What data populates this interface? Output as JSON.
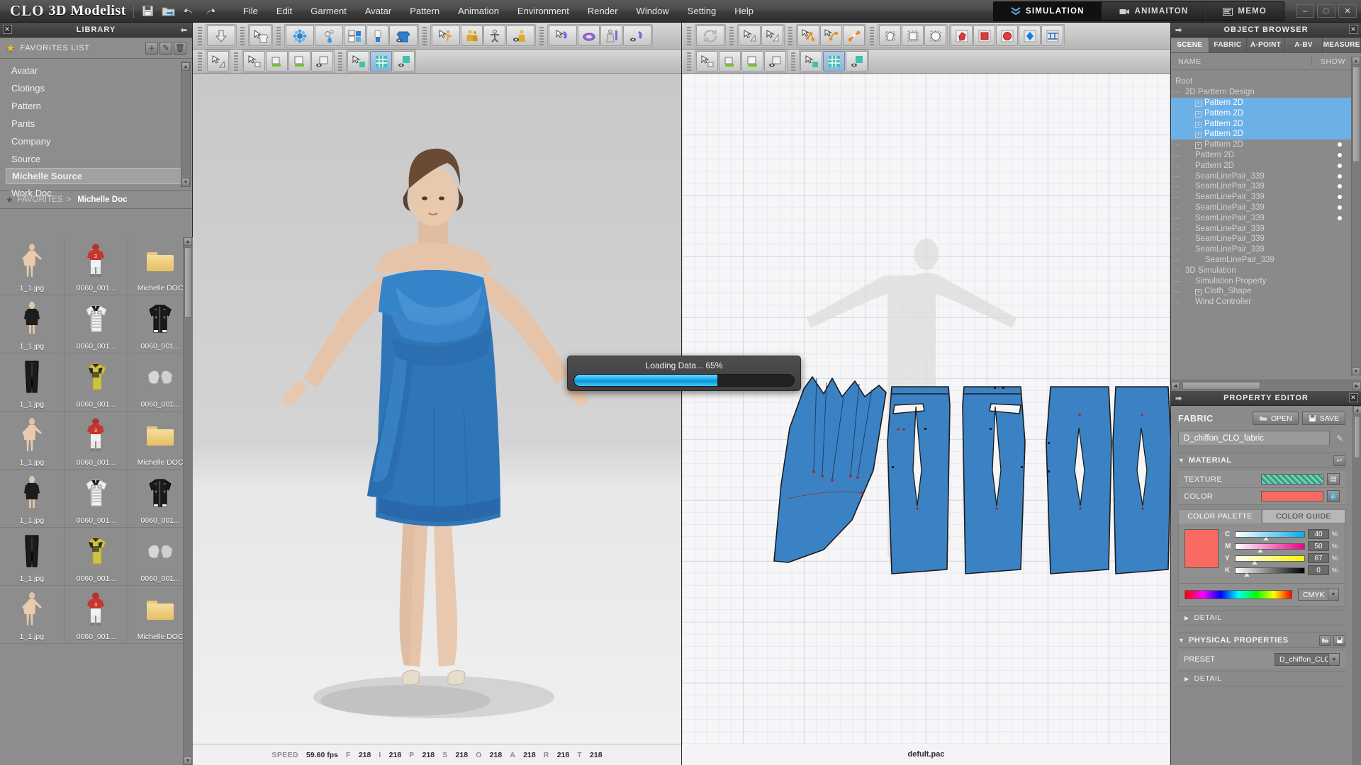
{
  "app": {
    "brand_clo": "CLO",
    "brand_suffix": "3D Modelist",
    "window_buttons": {
      "minimize": "–",
      "maximize": "□",
      "close": "✕"
    }
  },
  "titlebar": {
    "quick_icons": [
      {
        "name": "save-icon",
        "title": "Save"
      },
      {
        "name": "open-folder-icon",
        "title": "Open"
      },
      {
        "name": "undo-icon",
        "title": "Undo"
      },
      {
        "name": "redo-icon",
        "title": "Redo"
      }
    ],
    "menu": [
      "File",
      "Edit",
      "Garment",
      "Avatar",
      "Pattern",
      "Animation",
      "Environment",
      "Render",
      "Window",
      "Setting",
      "Help"
    ],
    "modes": [
      {
        "label": "SIMULATION",
        "icon": "chevrons-down-icon",
        "active": true
      },
      {
        "label": "ANIMAITON",
        "icon": "video-camera-icon",
        "active": false
      },
      {
        "label": "MEMO",
        "icon": "note-lines-icon",
        "active": false
      }
    ]
  },
  "library": {
    "title": "LIBRARY",
    "favorites_label": "FAVORITES LIST",
    "favorites_buttons": [
      {
        "name": "add-favorite-button",
        "glyph": "＋"
      },
      {
        "name": "edit-favorite-button",
        "glyph": "✎"
      },
      {
        "name": "delete-favorite-button",
        "glyph": "🗑"
      }
    ],
    "items": [
      {
        "label": "Avatar",
        "selected": false
      },
      {
        "label": "Clotings",
        "selected": false
      },
      {
        "label": "Pattern",
        "selected": false
      },
      {
        "label": "Pants",
        "selected": false
      },
      {
        "label": "Company",
        "selected": false
      },
      {
        "label": "Source",
        "selected": false
      },
      {
        "label": "Michelle Source",
        "selected": true
      },
      {
        "label": "Work Doc",
        "selected": false
      }
    ],
    "breadcrumb_root": "FAVORITES",
    "breadcrumb_sep": ">",
    "breadcrumb_current": "Michelle Doc",
    "thumbnails": [
      {
        "caption": "1_1.jpg",
        "art": "avatar-nude"
      },
      {
        "caption": "0060_001...",
        "art": "football-player"
      },
      {
        "caption": "Michelle DOC",
        "art": "folder"
      },
      {
        "caption": "1_1.jpg",
        "art": "black-dress"
      },
      {
        "caption": "0060_001...",
        "art": "striped-polo"
      },
      {
        "caption": "0060_001...",
        "art": "black-jacket"
      },
      {
        "caption": "1_1.jpg",
        "art": "black-pants"
      },
      {
        "caption": "0060_001...",
        "art": "yellow-tee"
      },
      {
        "caption": "0060_001...",
        "art": "shoulder-pads"
      },
      {
        "caption": "1_1.jpg",
        "art": "avatar-nude"
      },
      {
        "caption": "0060_001...",
        "art": "football-player"
      },
      {
        "caption": "Michelle DOC",
        "art": "folder"
      },
      {
        "caption": "1_1.jpg",
        "art": "black-dress"
      },
      {
        "caption": "0060_001...",
        "art": "striped-polo"
      },
      {
        "caption": "0060_001...",
        "art": "black-jacket"
      },
      {
        "caption": "1_1.jpg",
        "art": "black-pants"
      },
      {
        "caption": "0060_001...",
        "art": "yellow-tee"
      },
      {
        "caption": "0060_001...",
        "art": "shoulder-pads"
      },
      {
        "caption": "1_1.jpg",
        "art": "avatar-nude"
      },
      {
        "caption": "0060_001...",
        "art": "football-player"
      },
      {
        "caption": "Michelle DOC",
        "art": "folder"
      }
    ]
  },
  "viewport3d": {
    "status": {
      "speed_label": "SPEED",
      "speed_value": "59.60 fps",
      "counters": [
        {
          "key": "F",
          "value": "218"
        },
        {
          "key": "I",
          "value": "218"
        },
        {
          "key": "P",
          "value": "218"
        },
        {
          "key": "S",
          "value": "218"
        },
        {
          "key": "O",
          "value": "218"
        },
        {
          "key": "A",
          "value": "218"
        },
        {
          "key": "R",
          "value": "218"
        },
        {
          "key": "T",
          "value": "218"
        }
      ]
    },
    "toolbar_row1": [
      "gravity-drop-icon",
      "select-mesh-icon",
      "particle-distance-icon",
      "pin-drop-icon",
      "fold-arrange-icon",
      "tack-icon",
      "garment-hide-icon",
      "avatar-motion-icon",
      "avatar-pose-icon",
      "avatar-xray-icon",
      "avatar-hide-icon",
      "zipper-select-icon",
      "ring-icon",
      "avatar-measure-icon",
      "zipper-icon"
    ],
    "toolbar_row2": [
      "transform-icon",
      "select-pattern-icon",
      "flatten-icon",
      "arrange-icon",
      "layer-icon",
      "select-texture-icon",
      "texture-grid-icon",
      "texture-hide-icon"
    ]
  },
  "viewport2d": {
    "filename": "defult.pac",
    "toolbar_row1": [
      "sync-icon",
      "select-edit-icon",
      "edit-curve-icon",
      "transform-point-icon",
      "select-point-icon",
      "add-point-icon",
      "polygon-icon",
      "rectangle-icon",
      "circle-icon",
      "internal-polygon-icon",
      "internal-rect-icon",
      "internal-circle-icon",
      "dart-icon",
      "pleat-icon"
    ],
    "toolbar_row2": [
      "select-seam-icon",
      "seam-segment-icon",
      "seam-free-icon",
      "seam-hide-icon",
      "select-texture-icon",
      "texture-grid-icon",
      "texture-hide-icon"
    ],
    "patterns": [
      "draped-ruffle-panel",
      "front-left-panel",
      "front-right-panel",
      "back-left-panel",
      "back-right-panel"
    ]
  },
  "object_browser": {
    "title": "OBJECT BROWSER",
    "tabs": [
      {
        "label": "SCENE",
        "active": true
      },
      {
        "label": "FABRIC",
        "active": false
      },
      {
        "label": "A-POINT",
        "active": false
      },
      {
        "label": "A-BV",
        "active": false
      },
      {
        "label": "MEASURE",
        "active": false
      }
    ],
    "columns": {
      "name": "NAME",
      "show": "SHOW"
    },
    "tree": [
      {
        "label": "Root",
        "depth": 0,
        "expander": false,
        "selected": false,
        "dot": false
      },
      {
        "label": "2D Parttern Design",
        "depth": 1,
        "expander": false,
        "selected": false,
        "dot": false
      },
      {
        "label": "Pattern 2D",
        "depth": 2,
        "expander": true,
        "selected": true,
        "dot": false
      },
      {
        "label": "Pattern 2D",
        "depth": 2,
        "expander": true,
        "selected": true,
        "dot": false
      },
      {
        "label": "Pattern 2D",
        "depth": 2,
        "expander": true,
        "selected": true,
        "dot": false
      },
      {
        "label": "Pattern 2D",
        "depth": 2,
        "expander": true,
        "selected": true,
        "dot": false
      },
      {
        "label": "Pattern 2D",
        "depth": 2,
        "expander": true,
        "selected": false,
        "dot": true
      },
      {
        "label": "Pattern 2D",
        "depth": 2,
        "expander": false,
        "selected": false,
        "dot": true
      },
      {
        "label": "Pattern 2D",
        "depth": 2,
        "expander": false,
        "selected": false,
        "dot": true
      },
      {
        "label": "SeamLinePair_339",
        "depth": 2,
        "expander": false,
        "selected": false,
        "dot": true
      },
      {
        "label": "SeamLinePair_339",
        "depth": 2,
        "expander": false,
        "selected": false,
        "dot": true
      },
      {
        "label": "SeamLinePair_339",
        "depth": 2,
        "expander": false,
        "selected": false,
        "dot": true
      },
      {
        "label": "SeamLinePair_339",
        "depth": 2,
        "expander": false,
        "selected": false,
        "dot": true
      },
      {
        "label": "SeamLinePair_339",
        "depth": 2,
        "expander": false,
        "selected": false,
        "dot": true
      },
      {
        "label": "SeamLinePair_339",
        "depth": 2,
        "expander": false,
        "selected": false,
        "dot": false
      },
      {
        "label": "SeamLinePair_339",
        "depth": 2,
        "expander": false,
        "selected": false,
        "dot": false
      },
      {
        "label": "SeamLinePair_339",
        "depth": 2,
        "expander": false,
        "selected": false,
        "dot": false
      },
      {
        "label": "SeamLinePair_339",
        "depth": 3,
        "expander": false,
        "selected": false,
        "dot": false
      },
      {
        "label": "3D Simulation",
        "depth": 1,
        "expander": false,
        "selected": false,
        "dot": false
      },
      {
        "label": "Simulation Property",
        "depth": 2,
        "expander": false,
        "selected": false,
        "dot": false
      },
      {
        "label": "Cloth_Shape",
        "depth": 2,
        "expander": true,
        "selected": false,
        "dot": false
      },
      {
        "label": "Wind Controller",
        "depth": 2,
        "expander": false,
        "selected": false,
        "dot": false
      }
    ]
  },
  "property_editor": {
    "title": "PROPERTY EDITOR",
    "fabric_label": "FABRIC",
    "open_label": "OPEN",
    "save_label": "SAVE",
    "fabric_name": "D_chiffon_CLO_fabric",
    "material_section": "MATERIAL",
    "texture_label": "TEXTURE",
    "color_label": "COLOR",
    "color_hex": "#f96a62",
    "color_tabs": [
      {
        "label": "COLOR PALETTE",
        "active": true
      },
      {
        "label": "COLOR GUIDE",
        "active": false
      }
    ],
    "cmyk": [
      {
        "key": "C",
        "value": "40",
        "unit": "%"
      },
      {
        "key": "M",
        "value": "50",
        "unit": "%"
      },
      {
        "key": "Y",
        "value": "67",
        "unit": "%"
      },
      {
        "key": "K",
        "value": "0",
        "unit": "%"
      }
    ],
    "color_mode": "CMYK",
    "material_detail_label": "DETAIL",
    "physical_section": "PHYSICAL PROPERTIES",
    "preset_label": "PRESET",
    "preset_value": "D_chiffon_CLO...",
    "physical_detail_label": "DETAIL"
  },
  "loading_dialog": {
    "text": "Loading Data... 65%",
    "percent": 65,
    "fill_color": "#2fbdf5"
  }
}
